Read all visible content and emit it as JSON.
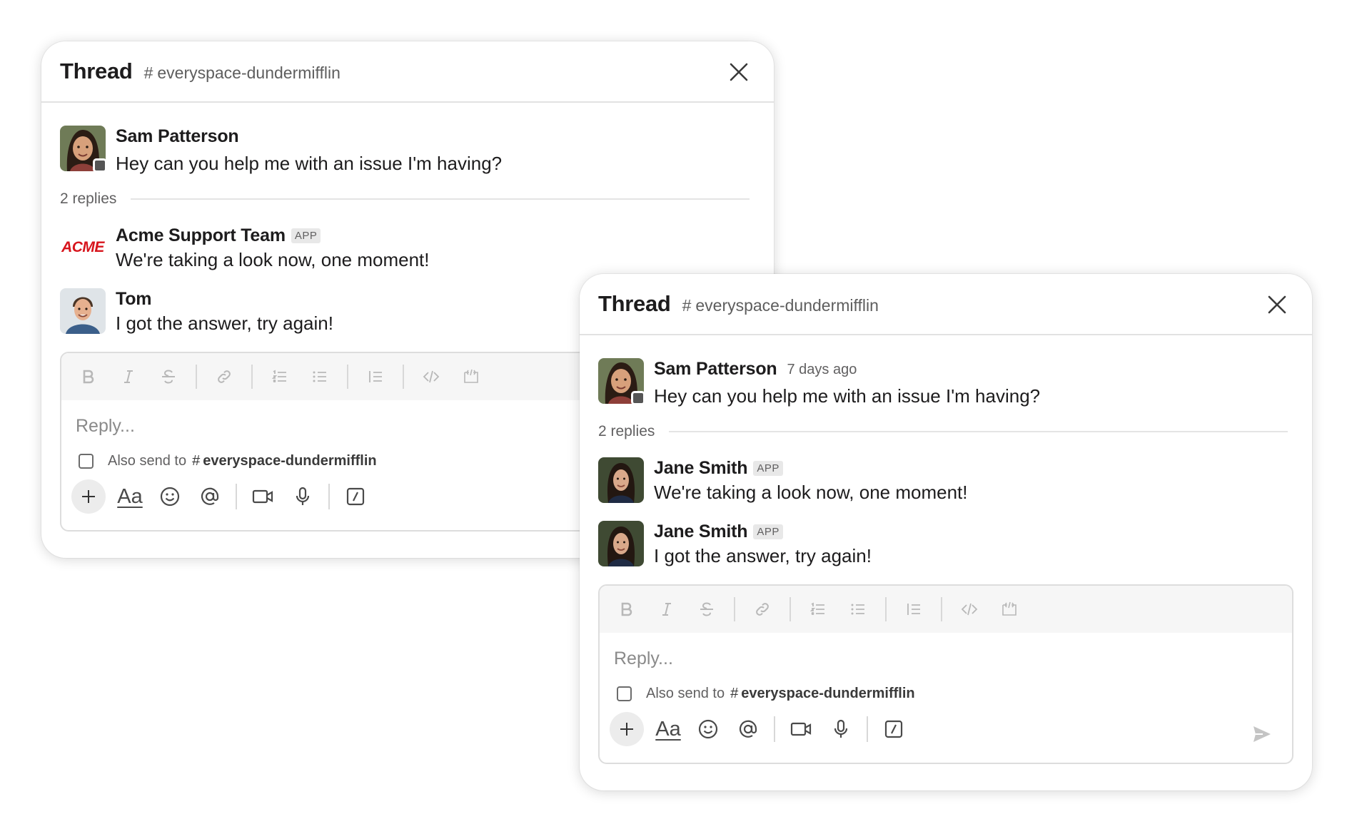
{
  "panels": {
    "a": {
      "title": "Thread",
      "channel": "everyspace-dundermifflin",
      "parent": {
        "author": "Sam Patterson",
        "text": "Hey can you help me with an issue I'm having?"
      },
      "replies_label": "2 replies",
      "replies": [
        {
          "author": "Acme Support Team",
          "badge": "APP",
          "text": "We're taking a look now, one moment!",
          "logo_text": "ACME"
        },
        {
          "author": "Tom",
          "text": "I got the answer, try again!"
        }
      ],
      "composer": {
        "placeholder": "Reply...",
        "also_send_label": "Also send to",
        "also_send_channel": "everyspace-dundermifflin",
        "aa_label": "Aa"
      }
    },
    "b": {
      "title": "Thread",
      "channel": "everyspace-dundermifflin",
      "parent": {
        "author": "Sam Patterson",
        "time": "7 days ago",
        "text": "Hey can you help me with an issue I'm having?"
      },
      "replies_label": "2 replies",
      "replies": [
        {
          "author": "Jane Smith",
          "badge": "APP",
          "text": "We're taking a look now, one moment!"
        },
        {
          "author": "Jane Smith",
          "badge": "APP",
          "text": "I got the answer, try again!"
        }
      ],
      "composer": {
        "placeholder": "Reply...",
        "also_send_label": "Also send to",
        "also_send_channel": "everyspace-dundermifflin",
        "aa_label": "Aa"
      }
    }
  },
  "hash_symbol": "#",
  "icons": {
    "close": "close-icon",
    "format": [
      "bold-icon",
      "italic-icon",
      "strikethrough-icon",
      "link-icon",
      "ordered-list-icon",
      "bulleted-list-icon",
      "blockquote-icon",
      "code-icon",
      "code-block-icon"
    ],
    "actions": [
      "plus-icon",
      "text-format-icon",
      "emoji-icon",
      "mention-icon",
      "video-icon",
      "microphone-icon",
      "slash-command-icon",
      "send-icon"
    ]
  },
  "colors": {
    "acme_red": "#d7141c",
    "presence": "#555555",
    "divider": "#e2e2e2"
  }
}
